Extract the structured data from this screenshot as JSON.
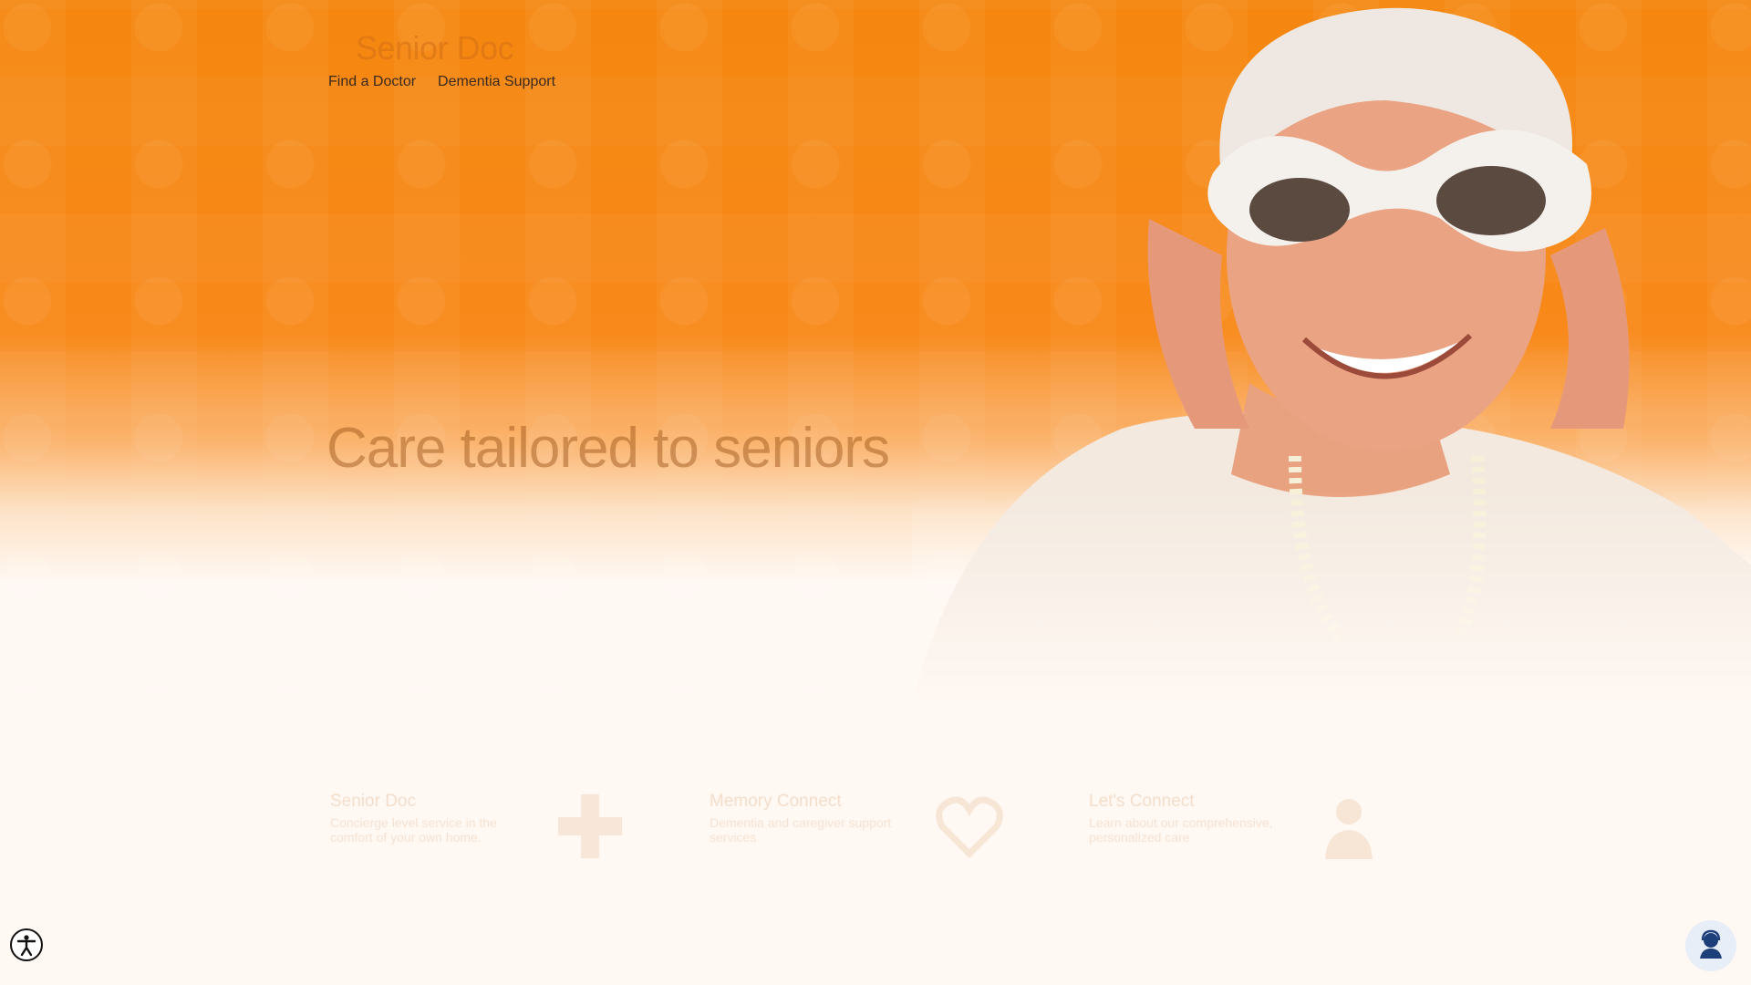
{
  "brand": {
    "logo_text": "Senior Doc"
  },
  "nav": {
    "items": [
      {
        "label": "Find a Doctor"
      },
      {
        "label": "Dementia Support"
      }
    ]
  },
  "hero": {
    "headline": "Care tailored to seniors"
  },
  "features": [
    {
      "title": "Senior Doc",
      "description": "Concierge level service in the comfort of your own home.",
      "icon": "medical-cross-icon"
    },
    {
      "title": "Memory Connect",
      "description": "Dementia and caregiver support services",
      "icon": "heart-icon"
    },
    {
      "title": "Let's Connect",
      "description": "Learn about our comprehensive, personalized care",
      "icon": "doctor-icon"
    }
  ],
  "widgets": {
    "accessibility_icon": "accessibility-icon",
    "chat_icon": "chat-agent-icon"
  },
  "colors": {
    "hero_orange": "#f5870f",
    "background": "#fff8f3",
    "nav_text": "#3a2a1e"
  }
}
